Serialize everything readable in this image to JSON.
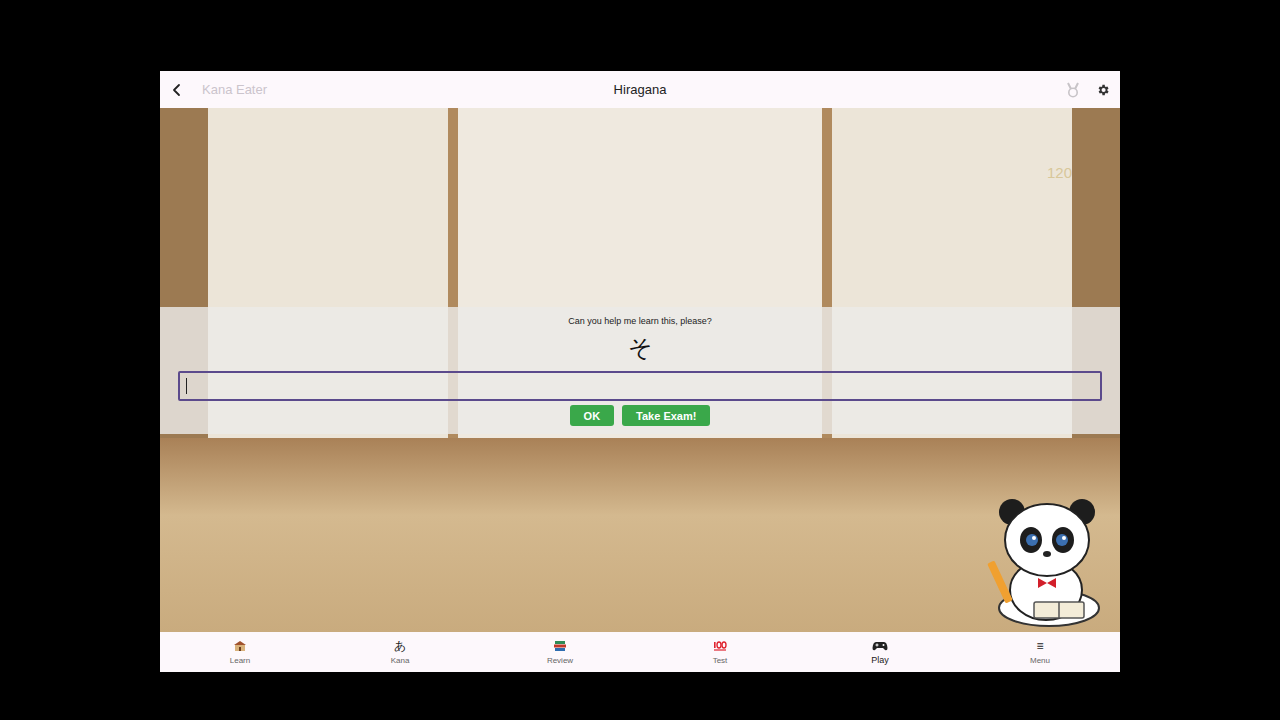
{
  "topbar": {
    "app_name": "Kana Eater",
    "title": "Hiragana"
  },
  "score": "120",
  "dialog": {
    "prompt": "Can you help me learn this, please?",
    "kana": "そ",
    "input": {
      "value": "",
      "focused": true
    },
    "buttons": [
      {
        "label": "OK"
      },
      {
        "label": "Take Exam!"
      }
    ]
  },
  "nav": [
    {
      "label": "Learn",
      "glyph": "",
      "selected": false
    },
    {
      "label": "Kana",
      "glyph": "あ",
      "selected": false
    },
    {
      "label": "Review",
      "glyph": "",
      "selected": false
    },
    {
      "label": "Test",
      "glyph": "",
      "selected": false
    },
    {
      "label": "Play",
      "glyph": "",
      "selected": true
    },
    {
      "label": "Menu",
      "glyph": "≡",
      "selected": false
    }
  ]
}
